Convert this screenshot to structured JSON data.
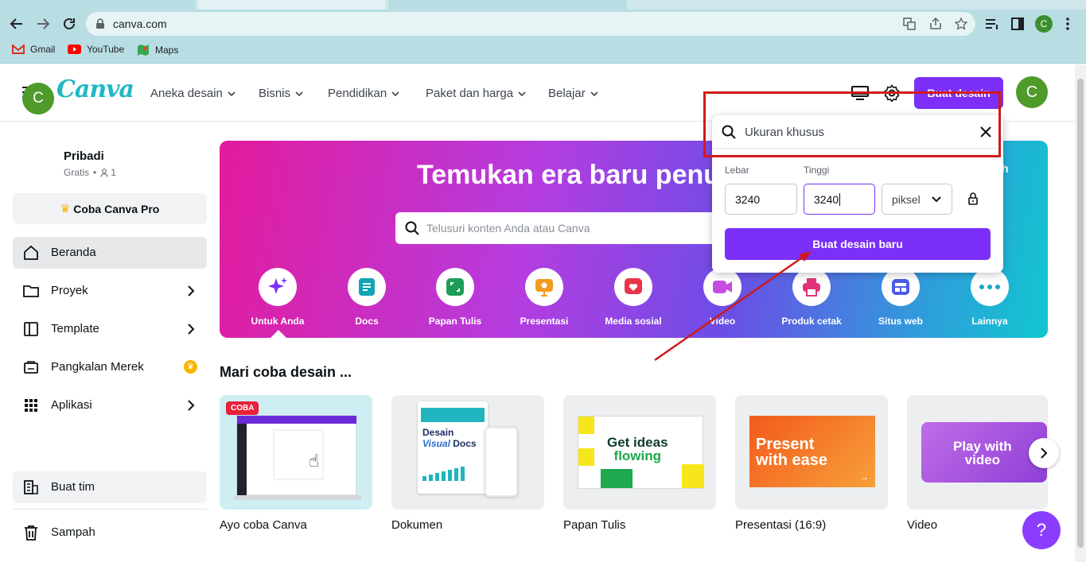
{
  "browser": {
    "url": "canva.com",
    "avatar_letter": "C",
    "bookmarks": [
      {
        "label": "Gmail",
        "icon": "gmail-icon"
      },
      {
        "label": "YouTube",
        "icon": "youtube-icon"
      },
      {
        "label": "Maps",
        "icon": "maps-icon"
      }
    ]
  },
  "header": {
    "logo": "Canva",
    "nav": [
      "Aneka desain",
      "Bisnis",
      "Pendidikan",
      "Paket dan harga",
      "Belajar"
    ],
    "create_button": "Buat desain",
    "avatar_letter": "C"
  },
  "sidebar": {
    "user_name": "Pribadi",
    "user_plan": "Gratis",
    "user_members": "1",
    "avatar_letter": "C",
    "pro_button": "Coba Canva Pro",
    "items": [
      {
        "label": "Beranda",
        "icon": "home-icon"
      },
      {
        "label": "Proyek",
        "icon": "folder-icon"
      },
      {
        "label": "Template",
        "icon": "template-icon"
      },
      {
        "label": "Pangkalan Merek",
        "icon": "brand-kit-icon"
      },
      {
        "label": "Aplikasi",
        "icon": "apps-grid-icon"
      }
    ],
    "team_button": "Buat tim",
    "trash": "Sampah"
  },
  "hero": {
    "title": "Temukan era baru penu",
    "title_tail": "gah",
    "search_placeholder": "Telusuri konten Anda atau Canva",
    "categories": [
      {
        "label": "Untuk Anda",
        "icon": "sparkle-icon"
      },
      {
        "label": "Docs",
        "icon": "docs-icon"
      },
      {
        "label": "Papan Tulis",
        "icon": "whiteboard-icon"
      },
      {
        "label": "Presentasi",
        "icon": "presentation-icon"
      },
      {
        "label": "Media sosial",
        "icon": "heart-icon"
      },
      {
        "label": "Video",
        "icon": "video-icon"
      },
      {
        "label": "Produk cetak",
        "icon": "print-icon"
      },
      {
        "label": "Situs web",
        "icon": "website-icon"
      },
      {
        "label": "Lainnya",
        "icon": "more-icon"
      }
    ]
  },
  "suggestions": {
    "title": "Mari coba desain ...",
    "badge": "COBA",
    "cards": [
      {
        "label": "Ayo coba Canva"
      },
      {
        "label": "Dokumen",
        "thumb_text": [
          "Desain",
          "Visual",
          "Docs"
        ]
      },
      {
        "label": "Papan Tulis",
        "thumb_text": [
          "Get ideas",
          "flowing"
        ]
      },
      {
        "label": "Presentasi (16:9)",
        "thumb_text": [
          "Present",
          "with ease"
        ]
      },
      {
        "label": "Video",
        "thumb_text": [
          "Play with",
          "video"
        ]
      }
    ]
  },
  "custom_size": {
    "search_value": "Ukuran khusus",
    "width_label": "Lebar",
    "height_label": "Tinggi",
    "width_value": "3240",
    "height_value": "3240",
    "unit": "piksel",
    "create_button": "Buat desain baru"
  },
  "help": "?"
}
